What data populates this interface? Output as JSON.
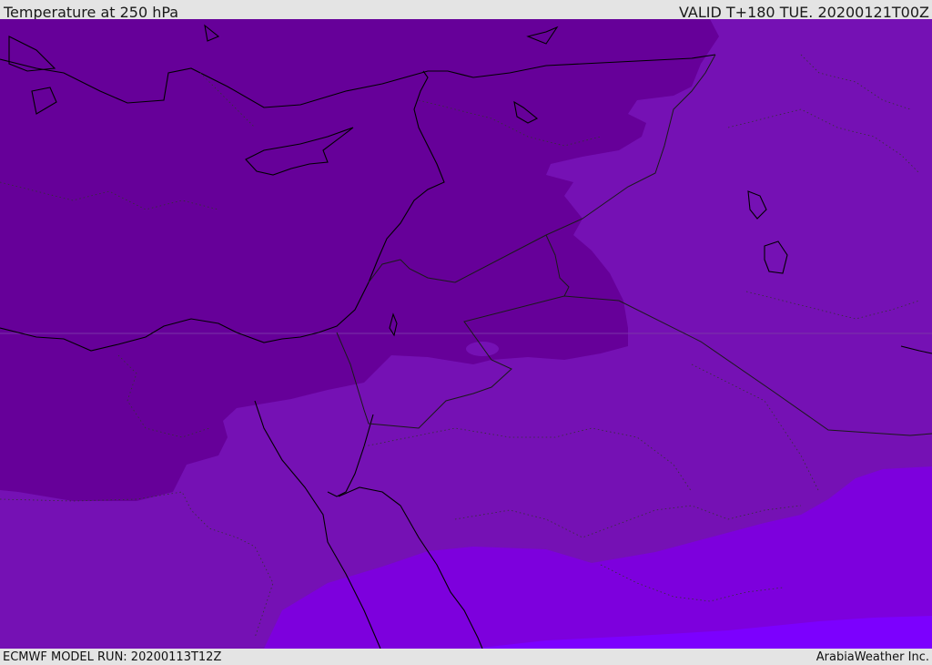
{
  "header": {
    "title": "Temperature at 250 hPa",
    "valid": "VALID T+180 TUE. 20200121T00Z"
  },
  "footer": {
    "model_run": "ECMWF MODEL RUN: 20200113T12Z",
    "brand": "ArabiaWeather Inc."
  },
  "map": {
    "region": "Eastern Mediterranean / Middle East",
    "colors": {
      "coldest": "#660099",
      "cold": "#7511b4",
      "mild": "#7d00dd",
      "warmest": "#7c00fe",
      "coastline": "#000000",
      "border": "#1a1a1a"
    }
  }
}
